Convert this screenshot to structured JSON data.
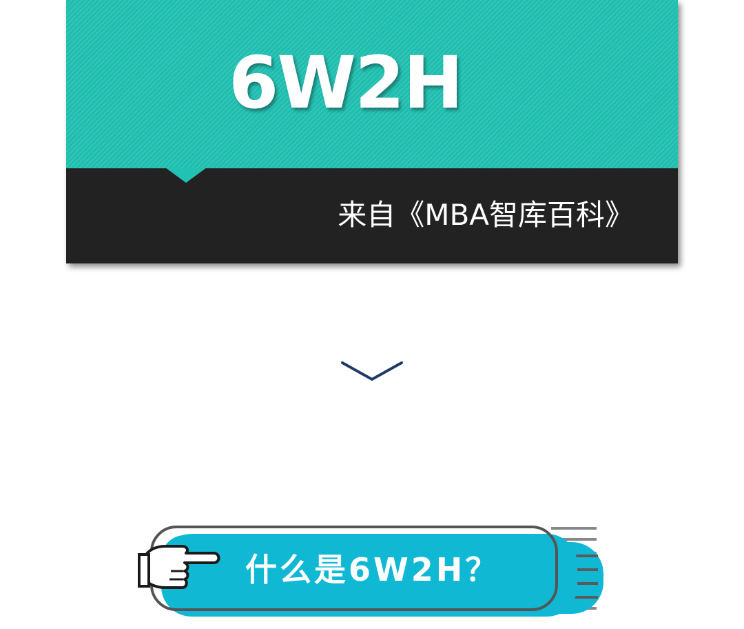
{
  "hero": {
    "title": "6W2H",
    "source": "来自《MBA智库百科》"
  },
  "icons": {
    "chevron": "chevron-down-icon",
    "hand": "pointing-hand-icon"
  },
  "section_banner": {
    "label": "什么是6W2H？"
  },
  "colors": {
    "teal": "#21c2b3",
    "dark": "#222223",
    "banner_blue": "#10b8d4",
    "banner_outline": "#555555",
    "chevron": "#1f3a66"
  }
}
